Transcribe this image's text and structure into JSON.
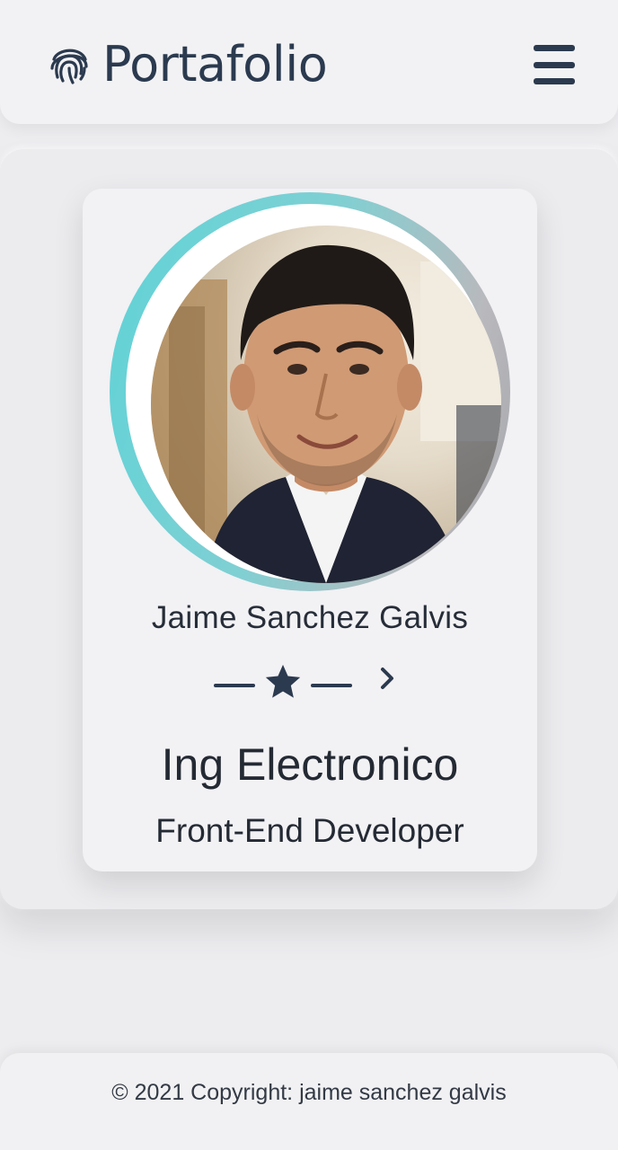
{
  "navbar": {
    "brand": "Portafolio",
    "brand_icon": "fingerprint-icon",
    "menu_icon": "hamburger-menu-icon"
  },
  "profile": {
    "name": "Jaime Sanchez Galvis",
    "title": "Ing Electronico",
    "subtitle": "Front-End Developer",
    "divider_icon": "star-icon",
    "next_icon": "chevron-right-icon"
  },
  "footer": {
    "text": "© 2021 Copyright: jaime sanchez galvis"
  },
  "colors": {
    "primary": "#2b3a4f",
    "ring_start": "#5fd3d7",
    "ring_end": "#a5a6ab",
    "background": "#ededf0"
  }
}
